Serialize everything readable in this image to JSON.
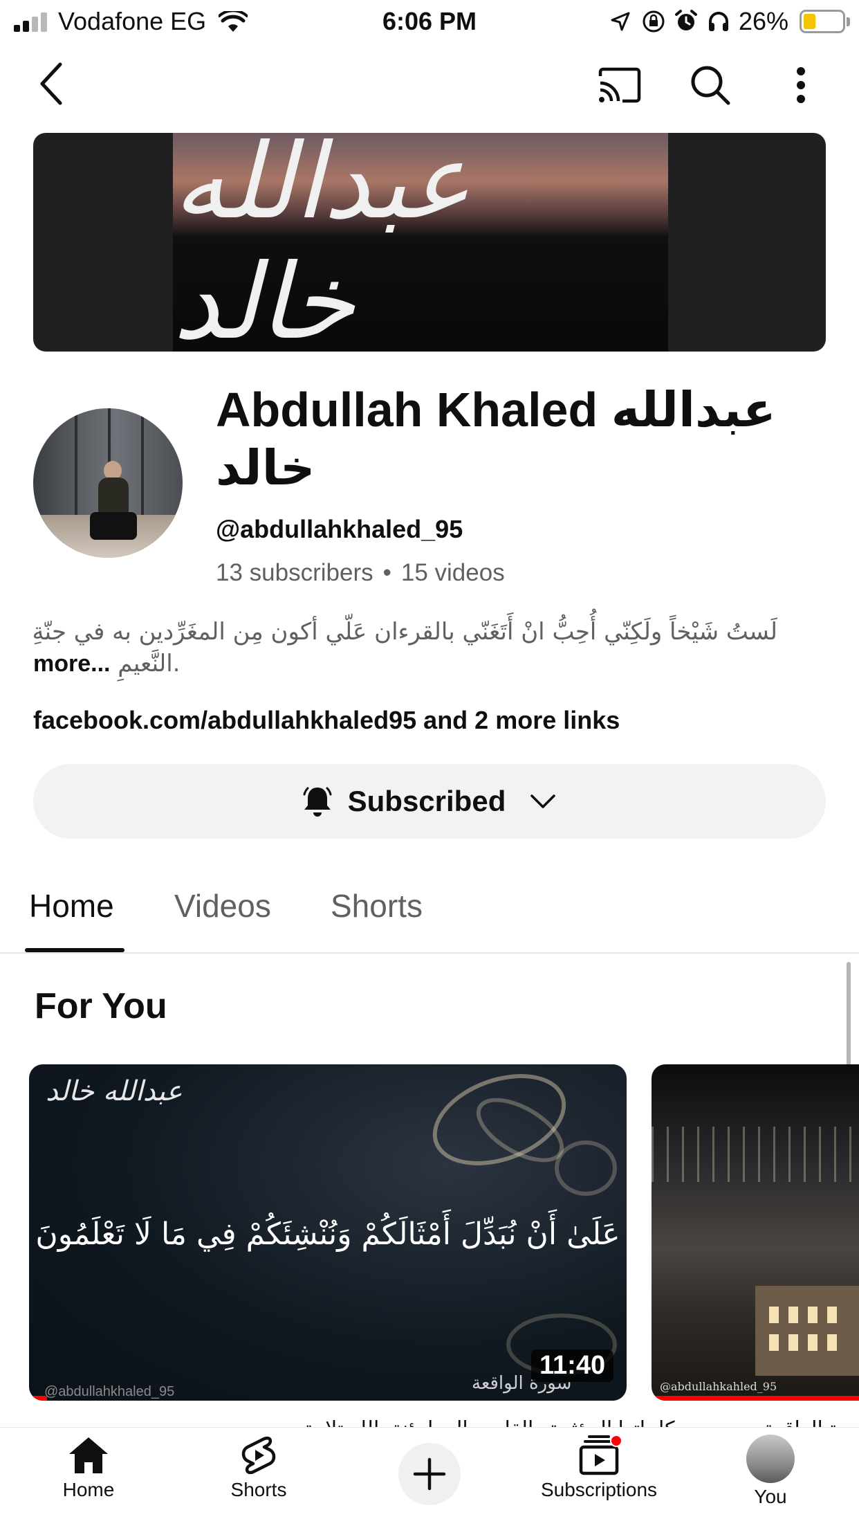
{
  "status_bar": {
    "carrier": "Vodafone EG",
    "time": "6:06 PM",
    "battery_percent": "26%",
    "icons": [
      "signal-icon",
      "wifi-icon",
      "location-icon",
      "rotation-lock-icon",
      "alarm-icon",
      "headphones-icon",
      "battery-icon"
    ]
  },
  "top_bar": {
    "icons": [
      "back-arrow-icon",
      "cast-icon",
      "search-icon",
      "more-vertical-icon"
    ]
  },
  "banner": {
    "art_text": "عبدالله خالد"
  },
  "channel": {
    "name": "Abdullah Khaled عبدالله خالد",
    "handle": "@abdullahkhaled_95",
    "subscribers": "13 subscribers",
    "separator": "•",
    "videos": "15 videos",
    "description_line1": "لَستُ شَيْخاً ولَكِنّي أُحِبُّ انْ أَتَغَنّي بالقرءان عَلّي أكون مِن المغَرِّدين به في جنّةِ",
    "description_line2": "النَّعيمِ.",
    "description_more": "more...",
    "links": "facebook.com/abdullahkhaled95 and 2 more links"
  },
  "subscribe_button": {
    "label": "Subscribed",
    "icons": [
      "bell-icon",
      "chevron-down-icon"
    ]
  },
  "tabs": [
    {
      "label": "Home",
      "active": true
    },
    {
      "label": "Videos",
      "active": false
    },
    {
      "label": "Shorts",
      "active": false
    }
  ],
  "section": {
    "title": "For You"
  },
  "videos": [
    {
      "logo_text": "عبدالله خالد",
      "verse_text": "عَلَىٰ أَنْ نُبَدِّلَ أَمْثَالَكُمْ وَنُنْشِئَكُمْ فِي مَا لَا تَعْلَمُونَ",
      "surah_text": "سورة الواقعة",
      "watermark": "@abdullahkhaled_95",
      "duration": "11:40",
      "progress": 0.03
    },
    {
      "watermark": "@abdullahkahled_95",
      "progress": 1.0
    }
  ],
  "title_peek": {
    "left": "ت",
    "right": "قرآن من سورة الواقعة بصوت ... كلماتها المؤثرة والقلوب المطمئنة بالله تلاوة"
  },
  "bottom_nav": [
    {
      "label": "Home",
      "icon": "home-icon"
    },
    {
      "label": "Shorts",
      "icon": "shorts-icon"
    },
    {
      "label": "",
      "icon": "create-plus-icon"
    },
    {
      "label": "Subscriptions",
      "icon": "subscriptions-icon"
    },
    {
      "label": "You",
      "icon": "profile-avatar-icon"
    }
  ],
  "colors": {
    "text_primary": "#0f0f0f",
    "text_secondary": "#606060",
    "accent_red": "#ff0000",
    "button_bg": "#f2f2f2"
  }
}
